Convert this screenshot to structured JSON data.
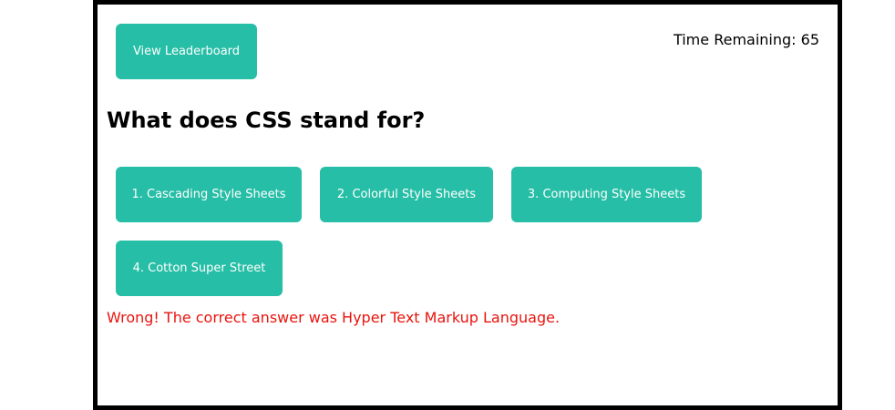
{
  "header": {
    "leaderboard_label": "View Leaderboard",
    "timer_text": "Time Remaining: 65"
  },
  "question": {
    "text": "What does CSS stand for?"
  },
  "options": [
    {
      "label": "1. Cascading Style Sheets"
    },
    {
      "label": "2. Colorful Style Sheets"
    },
    {
      "label": "3. Computing Style Sheets"
    },
    {
      "label": "4. Cotton Super Street"
    }
  ],
  "feedback": {
    "text": "Wrong! The correct answer was Hyper Text Markup Language."
  },
  "colors": {
    "button_bg": "#26bea6",
    "feedback_text": "#e8140e",
    "frame_border": "#000000"
  }
}
